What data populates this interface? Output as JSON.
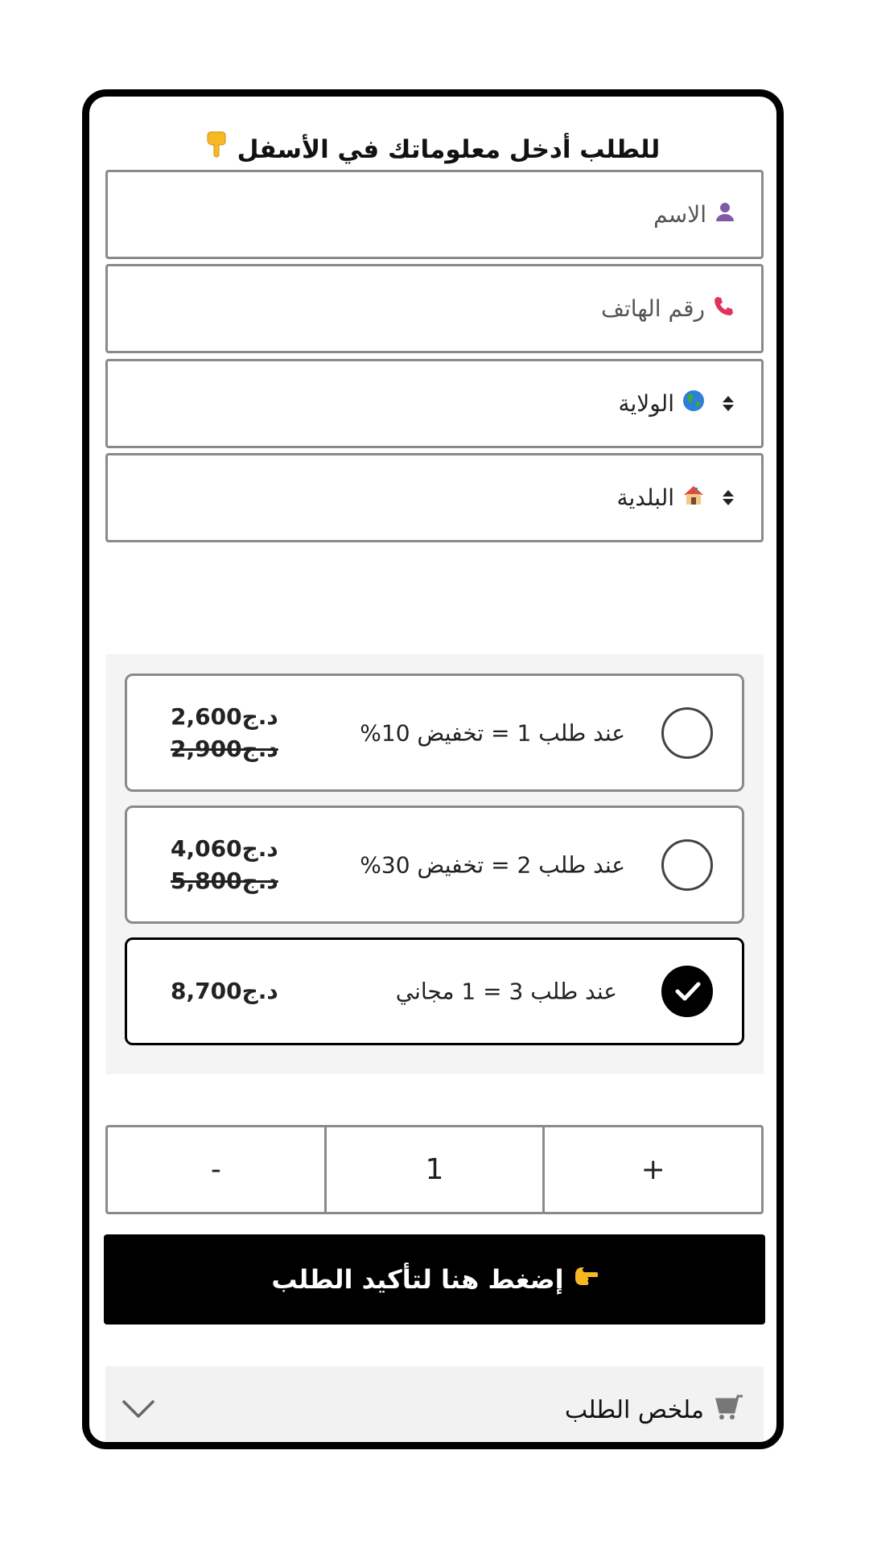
{
  "form": {
    "title": "للطلب أدخل معلوماتك في الأسفل",
    "title_icon": "pointing-down-hand-icon"
  },
  "fields": {
    "name_placeholder": "الاسم",
    "phone_placeholder": "رقم الهاتف",
    "wilaya_label": "الولاية",
    "commune_label": "البلدية"
  },
  "offers": [
    {
      "label": "عند طلب 1 = تخفيض 10%",
      "price": "2,600د.ج",
      "old_price": "2,900د.ج",
      "selected": false
    },
    {
      "label": "عند طلب 2 = تخفيض 30%",
      "price": "4,060د.ج",
      "old_price": "5,800د.ج",
      "selected": false
    },
    {
      "label": "عند طلب 3 = 1 مجاني",
      "price": "8,700د.ج",
      "old_price": "",
      "selected": true
    }
  ],
  "quantity": {
    "minus": "-",
    "value": "1",
    "plus": "+"
  },
  "confirm_button": {
    "label": "إضغط هنا لتأكيد الطلب"
  },
  "summary": {
    "label": "ملخص الطلب"
  },
  "colors": {
    "accent": "#000000",
    "panel": "#f4f4f4",
    "border": "#8a8a8a"
  }
}
